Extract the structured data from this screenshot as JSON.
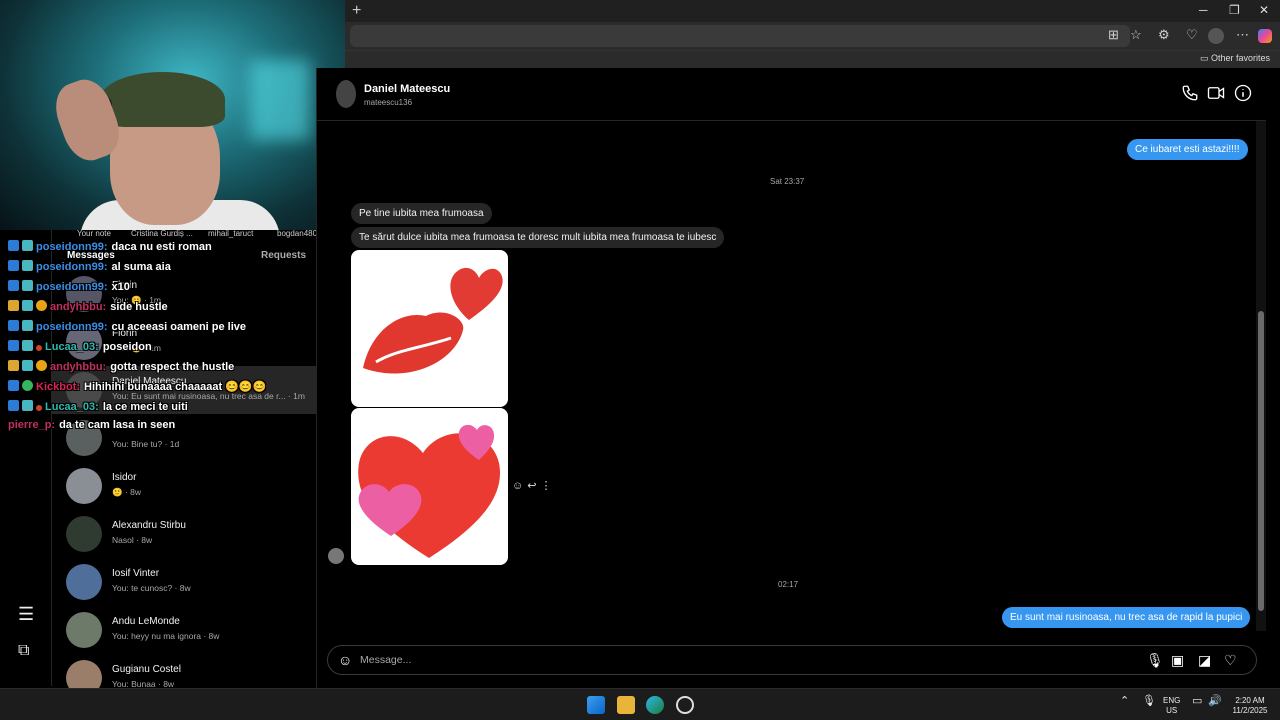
{
  "browser": {
    "other_favorites": "Other favorites"
  },
  "stories": {
    "notes": [
      "Your note",
      "Cristina Gurdiș ...",
      "mihail_taruct",
      "bogdan480"
    ]
  },
  "inbox": {
    "heading": "Messages",
    "requests": "Requests",
    "conversations": [
      {
        "name": "Florin",
        "sub": "You: 😊 · 1m"
      },
      {
        "name": "Florin",
        "sub": "You: 😊 · 1m"
      },
      {
        "name": "Daniel Mateescu",
        "sub": "You: Eu sunt mai rusinoasa, nu trec asa de r... · 1m"
      },
      {
        "name": "",
        "sub": "You: Bine tu? · 1d"
      },
      {
        "name": "Isidor",
        "sub": "🙂 · 8w"
      },
      {
        "name": "Alexandru Stirbu",
        "sub": "Nasol · 8w"
      },
      {
        "name": "Iosif Vinter",
        "sub": "You: te cunosc? · 8w"
      },
      {
        "name": "Andu LeMonde",
        "sub": "You: heyy nu ma ignora · 8w"
      },
      {
        "name": "Gugianu Costel",
        "sub": "You: Bunaa · 8w"
      }
    ]
  },
  "twitch_chat": [
    {
      "user": "poseidonn99:",
      "text": "daca nu esti roman",
      "color": "#3b8ee6"
    },
    {
      "user": "poseidonn99:",
      "text": "al suma aia",
      "color": "#3b8ee6"
    },
    {
      "user": "poseidonn99:",
      "text": "x10",
      "color": "#3b8ee6"
    },
    {
      "user": "andyhbbu:",
      "text": "side hustle",
      "color": "#c0305f"
    },
    {
      "user": "poseidonn99:",
      "text": "cu aceeasi oameni pe live",
      "color": "#3b8ee6"
    },
    {
      "user": "Lucaa_03:",
      "text": "poseidon",
      "color": "#2fb8b0"
    },
    {
      "user": "andyhbbu:",
      "text": "gotta respect the hustle",
      "color": "#c0305f"
    },
    {
      "user": "Kickbot:",
      "text": "Hihihihi bunaaaa chaaaaat 😊😊😊",
      "color": "#d6245a"
    },
    {
      "user": "Lucaa_03:",
      "text": "la ce meci te uiti",
      "color": "#2fb8b0"
    },
    {
      "user": "pierre_p:",
      "text": "da te cam lasa in seen",
      "color": "#c0305f"
    }
  ],
  "conversation": {
    "name": "Daniel Mateescu",
    "username": "mateescu136",
    "messages": {
      "out_1": "Ce iubaret esti astazi!!!!",
      "time_1": "Sat 23:37",
      "in_1": "Pe tine iubita mea frumoasa",
      "in_2": "Te sărut dulce iubita mea frumoasa te doresc mult iubita mea frumoasa te iubesc",
      "time_2": "02:17",
      "out_2": "Eu sunt mai rusinoasa, nu trec asa de rapid la pupici"
    },
    "composer_placeholder": "Message..."
  },
  "taskbar": {
    "lang_1": "ENG",
    "lang_2": "US",
    "time": "2:20 AM",
    "date": "11/2/2025"
  },
  "colors": {
    "accent": "#3797f0",
    "incoming_bubble": "#262626",
    "background": "#000000"
  }
}
